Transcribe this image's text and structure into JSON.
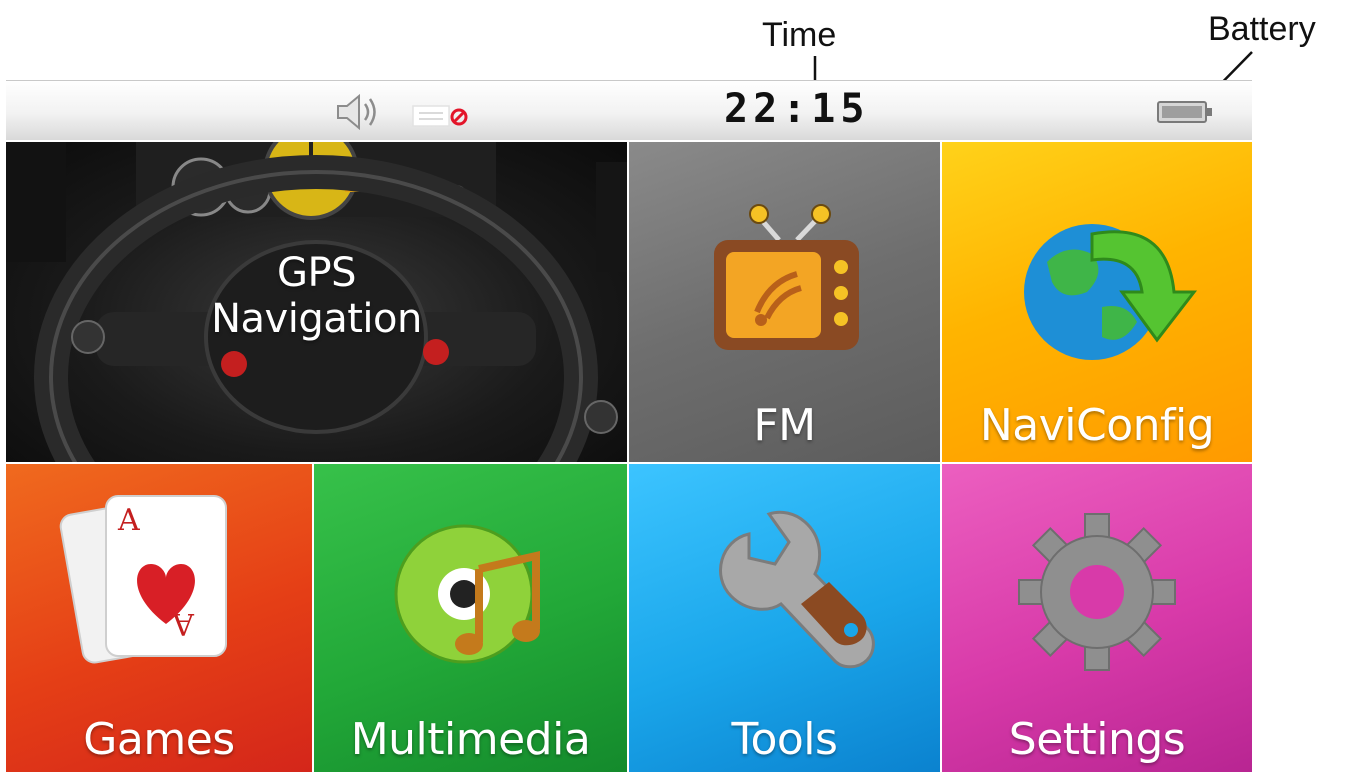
{
  "callouts": {
    "time": "Time",
    "battery": "Battery"
  },
  "status_bar": {
    "clock": "22:15",
    "icons": [
      "speaker-icon",
      "message-muted-icon",
      "battery-icon"
    ]
  },
  "tiles": {
    "gps": {
      "line1": "GPS",
      "line2": "Navigation",
      "icon": "steering-wheel-image"
    },
    "fm": {
      "label": "FM",
      "icon": "tv-radio-icon"
    },
    "naviconfig": {
      "label": "NaviConfig",
      "icon": "globe-arrow-icon"
    },
    "games": {
      "label": "Games",
      "icon": "playing-cards-icon"
    },
    "multimedia": {
      "label": "Multimedia",
      "icon": "music-disc-icon"
    },
    "tools": {
      "label": "Tools",
      "icon": "wrench-icon"
    },
    "settings": {
      "label": "Settings",
      "icon": "gear-icon"
    }
  },
  "colors": {
    "fm_tile": "#6e6e6e",
    "navi_tile": "#ffb400",
    "games_tile": "#e53f16",
    "multimedia_tile": "#22a838",
    "tools_tile": "#1aa6ea",
    "settings_tile": "#d83aa9"
  }
}
